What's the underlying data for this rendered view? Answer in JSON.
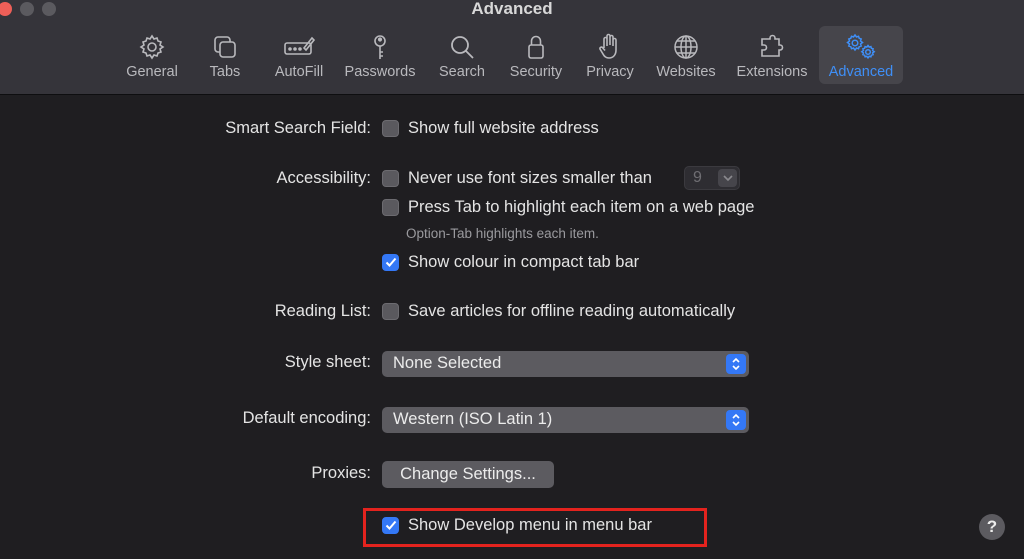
{
  "window": {
    "title": "Advanced"
  },
  "toolbar": {
    "items": [
      {
        "label": "General",
        "icon": "gear-icon"
      },
      {
        "label": "Tabs",
        "icon": "tabs-icon"
      },
      {
        "label": "AutoFill",
        "icon": "autofill-icon"
      },
      {
        "label": "Passwords",
        "icon": "key-icon"
      },
      {
        "label": "Search",
        "icon": "search-icon"
      },
      {
        "label": "Security",
        "icon": "lock-icon"
      },
      {
        "label": "Privacy",
        "icon": "hand-icon"
      },
      {
        "label": "Websites",
        "icon": "globe-icon"
      },
      {
        "label": "Extensions",
        "icon": "puzzle-icon"
      },
      {
        "label": "Advanced",
        "icon": "gears-icon",
        "selected": true
      }
    ]
  },
  "settings": {
    "smart_search": {
      "label": "Smart Search Field:",
      "option": "Show full website address",
      "checked": false
    },
    "accessibility": {
      "label": "Accessibility:",
      "font_size_option": "Never use font sizes smaller than",
      "font_size_checked": false,
      "font_size_value": "9",
      "tab_option": "Press Tab to highlight each item on a web page",
      "tab_checked": false,
      "tab_hint": "Option-Tab highlights each item.",
      "compact_option": "Show colour in compact tab bar",
      "compact_checked": true
    },
    "reading_list": {
      "label": "Reading List:",
      "option": "Save articles for offline reading automatically",
      "checked": false
    },
    "style_sheet": {
      "label": "Style sheet:",
      "value": "None Selected"
    },
    "encoding": {
      "label": "Default encoding:",
      "value": "Western (ISO Latin 1)"
    },
    "proxies": {
      "label": "Proxies:",
      "button": "Change Settings..."
    },
    "develop": {
      "option": "Show Develop menu in menu bar",
      "checked": true
    }
  },
  "help": {
    "label": "?"
  },
  "colors": {
    "accent": "#3478f6",
    "highlight_box": "#e3231e",
    "background": "#1f1e21"
  }
}
